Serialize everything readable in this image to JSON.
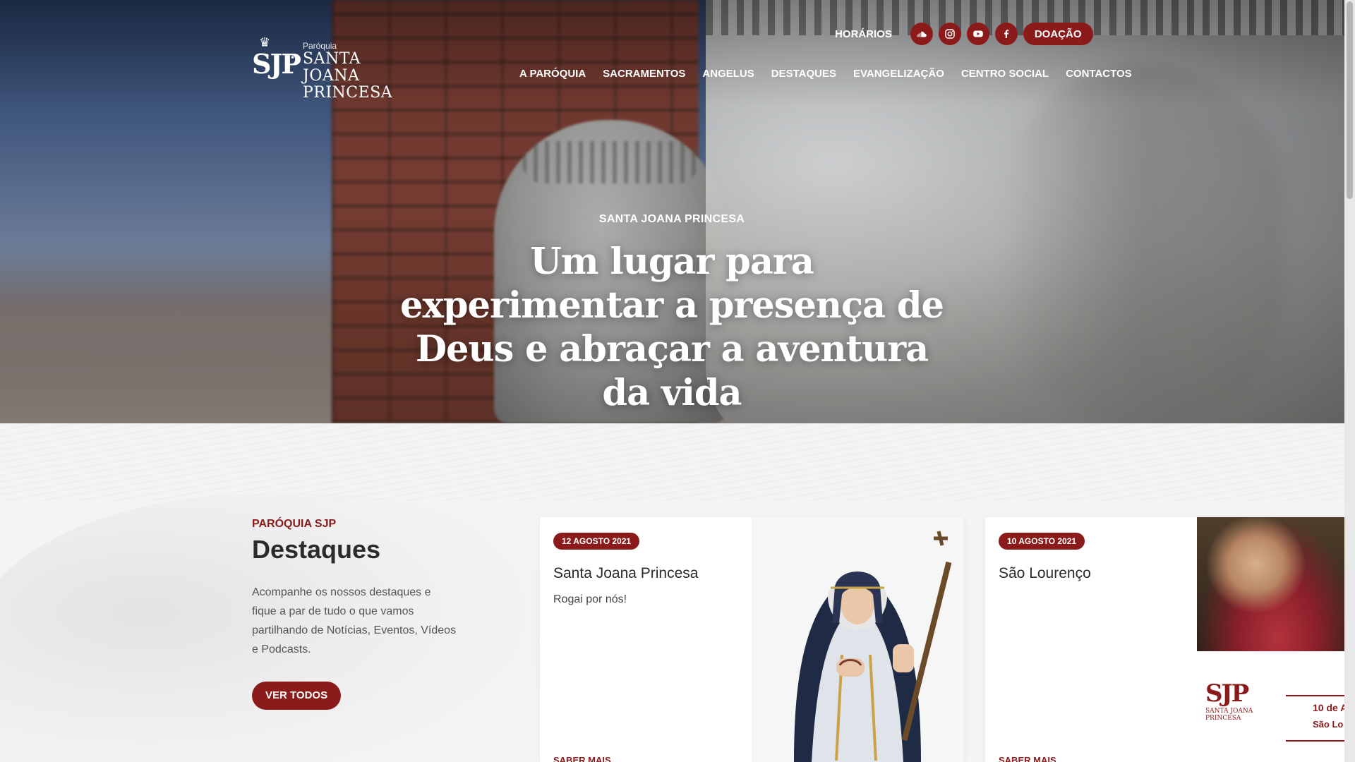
{
  "header": {
    "logo": {
      "monogram": "SJP",
      "small": "Paróquia",
      "name_line1": "SANTA JOANA",
      "name_line2": "PRINCESA"
    },
    "topbar": {
      "horarios": "HORÁRIOS",
      "social": [
        "soundcloud-icon",
        "instagram-icon",
        "youtube-icon",
        "facebook-icon"
      ],
      "donate": "DOAÇÃO"
    },
    "nav": [
      "A PARÓQUIA",
      "SACRAMENTOS",
      "ANGELUS",
      "DESTAQUES",
      "EVANGELIZAÇÃO",
      "CENTRO SOCIAL",
      "CONTACTOS"
    ]
  },
  "hero": {
    "eyebrow": "SANTA JOANA PRINCESA",
    "headline": "Um lugar para experimentar a presença de Deus e abraçar a aventura da vida"
  },
  "destaques": {
    "eyebrow": "PARÓQUIA SJP",
    "title": "Destaques",
    "description": "Acompanhe os nossos destaques e fique a par de tudo o que vamos partilhando de Notícias, Eventos, Vídeos e Podcasts.",
    "button": "VER TODOS"
  },
  "cards": [
    {
      "date": "12 AGOSTO 2021",
      "title": "Santa Joana Princesa",
      "subtitle": "Rogai por nós!",
      "more": "SABER MAIS"
    },
    {
      "date": "10 AGOSTO 2021",
      "title": "São Lourenço",
      "subtitle": "",
      "more": "SABER MAIS",
      "slide": {
        "logo": "SJP",
        "logo_name_line1": "SANTA JOANA",
        "logo_name_line2": "PRINCESA",
        "date": "10 de A",
        "name": "São Lo"
      }
    }
  ],
  "colors": {
    "accent": "#8b1a1a",
    "text": "#2b2b2b",
    "background": "#f4f4f4"
  }
}
